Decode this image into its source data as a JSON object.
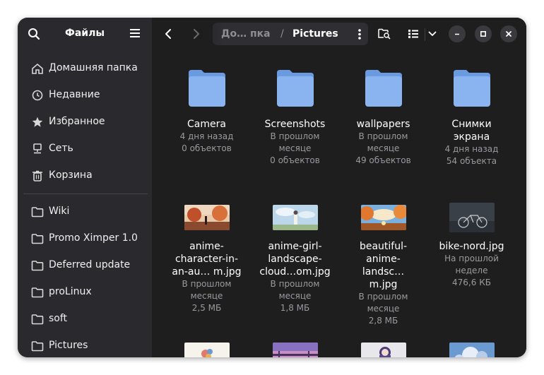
{
  "sidebar": {
    "title": "Файлы",
    "places": [
      {
        "label": "Домашняя папка",
        "icon": "home-icon"
      },
      {
        "label": "Недавние",
        "icon": "clock-icon"
      },
      {
        "label": "Избранное",
        "icon": "star-icon"
      },
      {
        "label": "Сеть",
        "icon": "network-icon"
      },
      {
        "label": "Корзина",
        "icon": "trash-icon"
      }
    ],
    "bookmarks": [
      {
        "label": "Wiki",
        "icon": "folder-icon"
      },
      {
        "label": "Promo Ximper 1.0",
        "icon": "folder-icon"
      },
      {
        "label": "Deferred update",
        "icon": "folder-icon"
      },
      {
        "label": "proLinux",
        "icon": "folder-icon"
      },
      {
        "label": "soft",
        "icon": "folder-icon"
      },
      {
        "label": "Pictures",
        "icon": "folder-icon"
      }
    ]
  },
  "pathbar": {
    "parent": "До… пка",
    "separator": "/",
    "current": "Pictures"
  },
  "colors": {
    "folder": "#8ab4f0",
    "folder_dark": "#6a9be0",
    "sidebar_bg": "#2a2a2e",
    "content_bg": "#1e1e1e"
  },
  "items": [
    {
      "type": "folder",
      "name": "Camera",
      "sub1": "4 дня назад",
      "sub2": "0 объектов"
    },
    {
      "type": "folder",
      "name": "Screenshots",
      "sub1": "В прошлом месяце",
      "sub2": "0 объектов"
    },
    {
      "type": "folder",
      "name": "wallpapers",
      "sub1": "В прошлом месяце",
      "sub2": "49 объектов"
    },
    {
      "type": "folder",
      "name": "Снимки экрана",
      "sub1": "4 дня назад",
      "sub2": "54 объекта"
    },
    {
      "type": "image",
      "name": "anime-character-in-an-au… m.jpg",
      "sub1": "В прошлом месяце",
      "sub2": "2,5 МБ"
    },
    {
      "type": "image",
      "name": "anime-girl-landscape-cloud…om.jpg",
      "sub1": "В прошлом месяце",
      "sub2": "1,8 МБ"
    },
    {
      "type": "image",
      "name": "beautiful-anime-landsc… m.jpg",
      "sub1": "В прошлом месяце",
      "sub2": "2,8 МБ"
    },
    {
      "type": "image",
      "name": "bike-nord.jpg",
      "sub1": "На прошлой неделе",
      "sub2": "476,6 КБ"
    }
  ]
}
